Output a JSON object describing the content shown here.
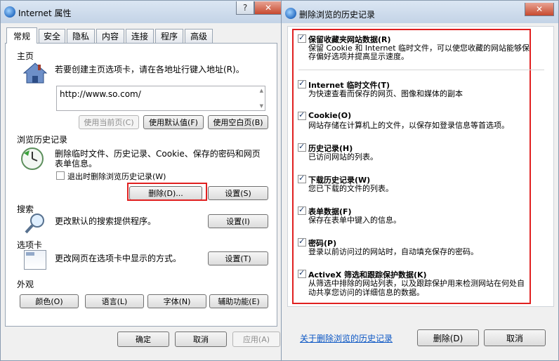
{
  "ie_props": {
    "title": "Internet 属性",
    "help": "?",
    "close": "✕",
    "tabs": [
      "常规",
      "安全",
      "隐私",
      "内容",
      "连接",
      "程序",
      "高级"
    ],
    "homepage": {
      "heading": "主页",
      "desc": "若要创建主页选项卡，请在各地址行键入地址(R)。",
      "url": "http://www.so.com/",
      "btn_current": "使用当前页(C)",
      "btn_default": "使用默认值(F)",
      "btn_blank": "使用空白页(B)"
    },
    "history": {
      "heading": "浏览历史记录",
      "desc_line1": "删除临时文件、历史记录、Cookie、保存的密码和网页",
      "desc_line2": "表单信息。",
      "checkbox": "退出时删除浏览历史记录(W)",
      "btn_delete": "删除(D)...",
      "btn_settings": "设置(S)"
    },
    "search": {
      "heading": "搜索",
      "desc": "更改默认的搜索提供程序。",
      "btn_settings": "设置(I)"
    },
    "tabs_section": {
      "heading": "选项卡",
      "desc": "更改网页在选项卡中显示的方式。",
      "btn_settings": "设置(T)"
    },
    "appearance": {
      "heading": "外观",
      "btn_colors": "颜色(O)",
      "btn_languages": "语言(L)",
      "btn_fonts": "字体(N)",
      "btn_access": "辅助功能(E)"
    },
    "footer": {
      "ok": "确定",
      "cancel": "取消",
      "apply": "应用(A)"
    }
  },
  "delete_dialog": {
    "title": "删除浏览的历史记录",
    "close": "✕",
    "items": [
      {
        "title": "保留收藏夹网站数据(R)",
        "desc1": "保留 Cookie 和 Internet 临时文件，可以使您收藏的网站能够保",
        "desc2": "存偏好选项并提高显示速度。",
        "checked": true
      },
      {
        "title": "Internet 临时文件(T)",
        "desc1": "为快速查看而保存的网页、图像和媒体的副本",
        "desc2": "",
        "checked": true
      },
      {
        "title": "Cookie(O)",
        "desc1": "网站存储在计算机上的文件，以保存如登录信息等首选项。",
        "desc2": "",
        "checked": true
      },
      {
        "title": "历史记录(H)",
        "desc1": "已访问网站的列表。",
        "desc2": "",
        "checked": true
      },
      {
        "title": "下载历史记录(W)",
        "desc1": "您已下载的文件的列表。",
        "desc2": "",
        "checked": true
      },
      {
        "title": "表单数据(F)",
        "desc1": "保存在表单中键入的信息。",
        "desc2": "",
        "checked": true
      },
      {
        "title": "密码(P)",
        "desc1": "登录以前访问过的网站时，自动填充保存的密码。",
        "desc2": "",
        "checked": true
      },
      {
        "title": "ActiveX 筛选和跟踪保护数据(K)",
        "desc1": "从筛选中排除的网站列表，以及跟踪保护用来检测网站在何处自",
        "desc2": "动共享您访问的详细信息的数据。",
        "checked": true
      }
    ],
    "about_link": "关于删除浏览的历史记录",
    "btn_delete": "删除(D)",
    "btn_cancel": "取消"
  }
}
